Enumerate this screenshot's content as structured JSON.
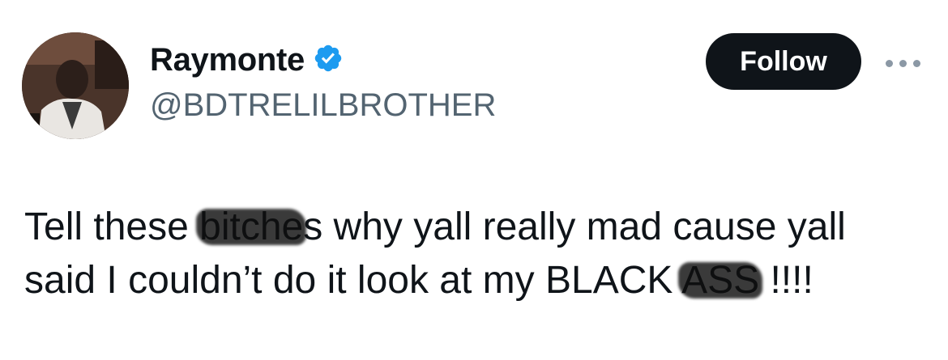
{
  "user": {
    "display_name": "Raymonte",
    "handle": "@BDTRELILBROTHER",
    "verified": true,
    "verified_icon": "verified-badge-icon",
    "verified_color": "#1d9bf0"
  },
  "actions": {
    "follow_label": "Follow",
    "more_icon": "more-horizontal-icon"
  },
  "tweet": {
    "line1_a": "Tell these ",
    "line1_redacted": "bitche",
    "line1_b": "s why yall really mad cause yall",
    "line2_a": "said I couldn’t do it look at my BLACK ",
    "line2_redacted": "ASS",
    "line2_b": " !!!!"
  }
}
